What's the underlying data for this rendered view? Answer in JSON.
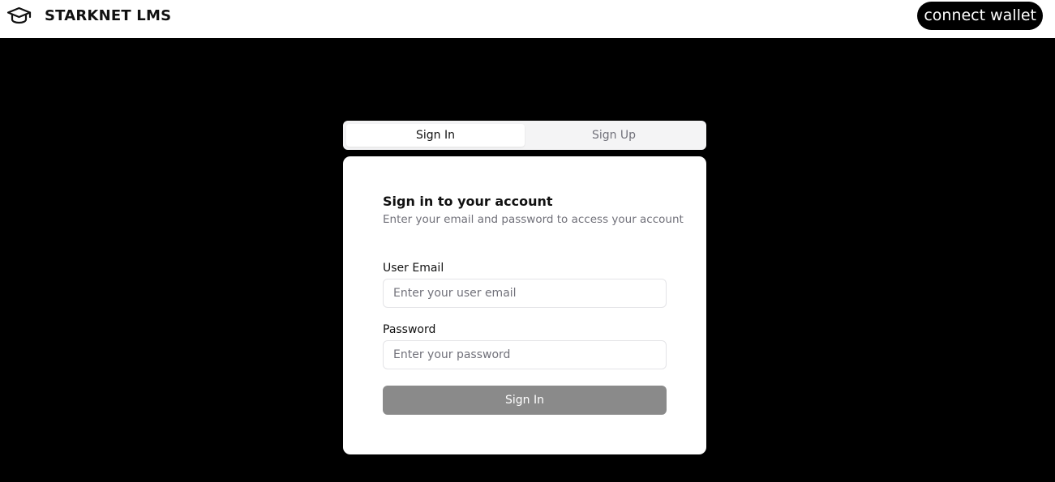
{
  "header": {
    "brand_icon": "graduation-cap-icon",
    "brand_name": "STARKNET LMS",
    "connect_wallet_label": "connect wallet"
  },
  "auth_tabs": [
    {
      "label": "Sign In",
      "active": true
    },
    {
      "label": "Sign Up",
      "active": false
    }
  ],
  "signin_card": {
    "title": "Sign in to your account",
    "description": "Enter your email and password to access your account",
    "email_label": "User Email",
    "email_placeholder": "Enter your user email",
    "email_value": "",
    "password_label": "Password",
    "password_placeholder": "Enter your password",
    "password_value": "",
    "submit_label": "Sign In"
  },
  "colors": {
    "page_background": "#000000",
    "header_background": "#ffffff",
    "button_disabled": "#8a8a8a",
    "muted_text": "#71717a"
  }
}
